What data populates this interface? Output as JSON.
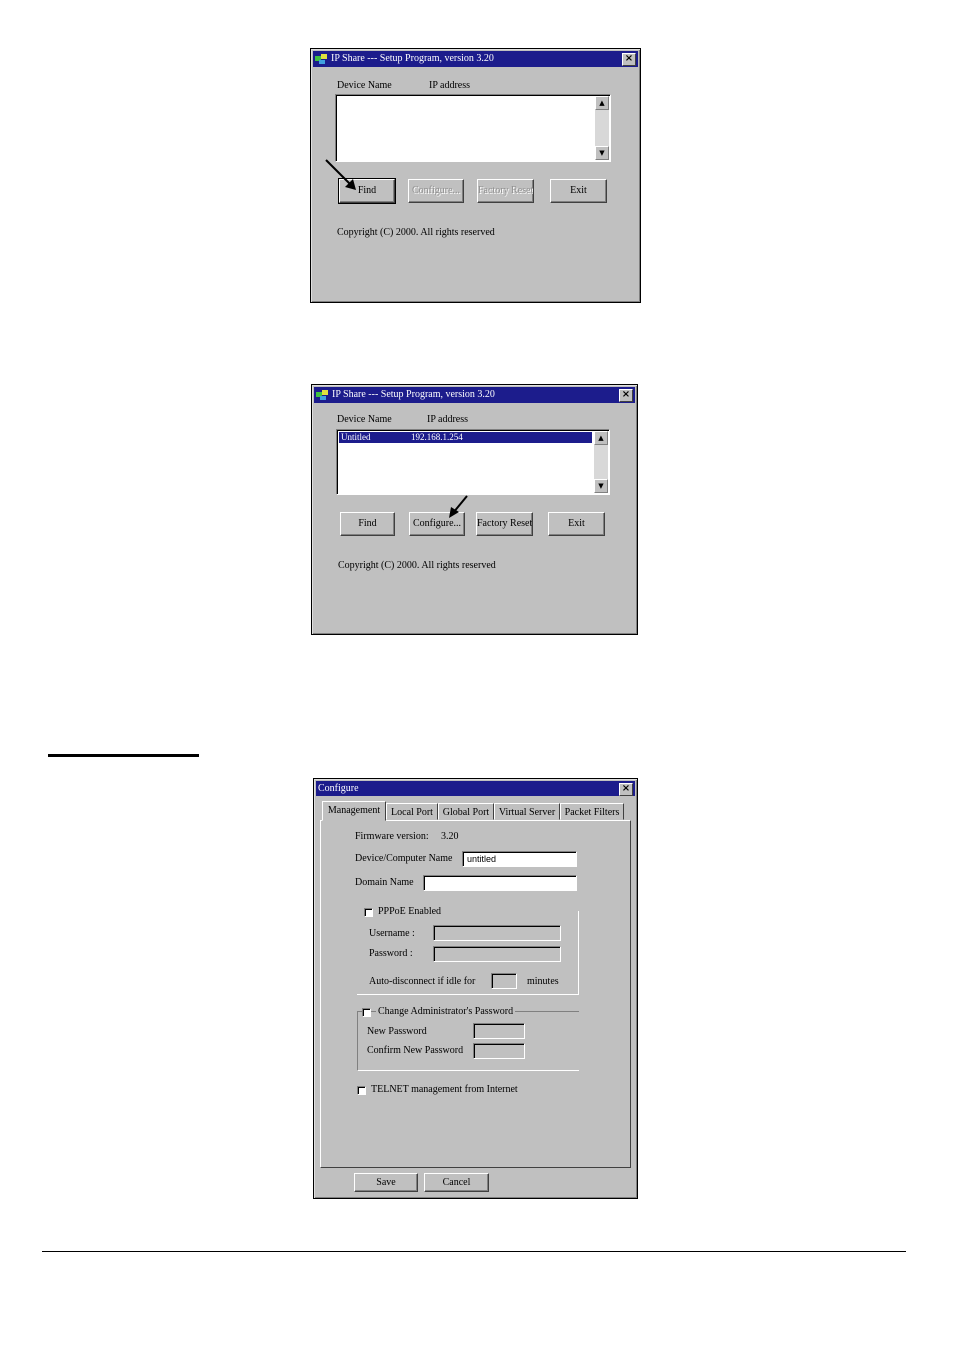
{
  "window1": {
    "title": "IP Share --- Setup Program, version 3.20",
    "col_device": "Device Name",
    "col_ip": "IP address",
    "find": "Find",
    "configure": "Configure...",
    "factory_reset": "Factory Reset",
    "exit": "Exit",
    "copyright": "Copyright (C) 2000.  All rights reserved"
  },
  "window2": {
    "title": "IP Share --- Setup Program, version 3.20",
    "col_device": "Device Name",
    "col_ip": "IP address",
    "row_device": "Untitled",
    "row_ip": "192.168.1.254",
    "find": "Find",
    "configure": "Configure...",
    "factory_reset": "Factory Reset",
    "exit": "Exit",
    "copyright": "Copyright (C) 2000.  All rights reserved"
  },
  "configure": {
    "title": "Configure",
    "tabs": [
      "Management",
      "Local Port",
      "Global Port",
      "Virtual Server",
      "Packet Filters"
    ],
    "firmware_label": "Firmware version:",
    "firmware_value": "3.20",
    "device_name_label": "Device/Computer Name",
    "device_name_value": "untitled",
    "domain_label": "Domain Name",
    "domain_value": "",
    "pppoe_label": "PPPoE Enabled",
    "username_label": "Username :",
    "password_label": "Password :",
    "autodisconnect_label": "Auto-disconnect if idle for",
    "autodisconnect_value": "",
    "minutes_label": "minutes",
    "change_pw_label": "Change Administrator's Password",
    "new_pw_label": "New Password",
    "confirm_pw_label": "Confirm New Password",
    "telnet_label": "TELNET management from Internet",
    "save": "Save",
    "cancel": "Cancel"
  },
  "colors": {
    "titlebar": "#1c1c8c",
    "window_face": "#c0c0c0"
  }
}
